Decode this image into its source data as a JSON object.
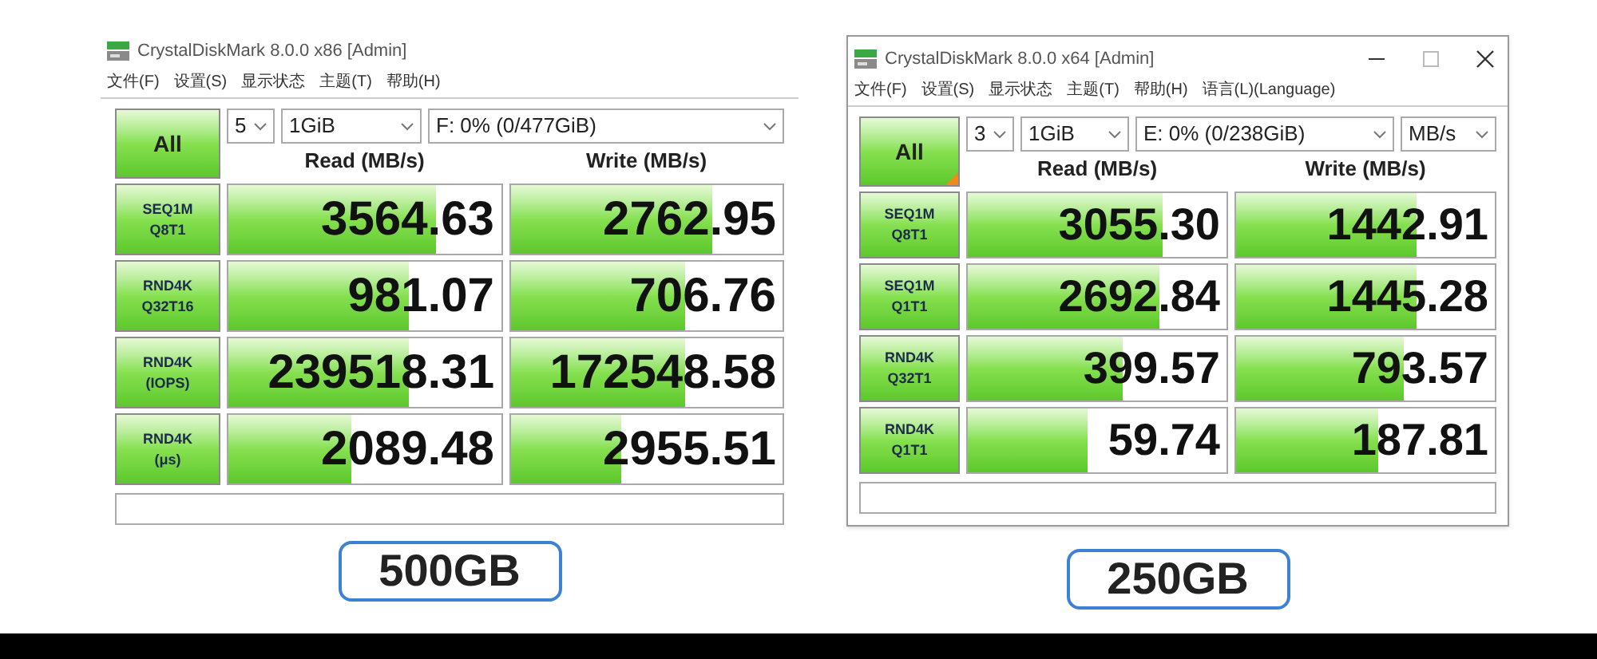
{
  "panels": [
    {
      "window": {
        "title": "CrystalDiskMark 8.0.0 x86 [Admin]",
        "window_controls": false
      },
      "menu": [
        "文件(F)",
        "设置(S)",
        "显示状态",
        "主题(T)",
        "帮助(H)"
      ],
      "all_button": {
        "label": "All",
        "marked": false
      },
      "settings": {
        "count": "5",
        "size": "1GiB",
        "drive": "F: 0% (0/477GiB)"
      },
      "columns": [
        "Read (MB/s)",
        "Write (MB/s)"
      ],
      "rows": [
        {
          "test": "SEQ1M",
          "params": "Q8T1",
          "read": {
            "value": "3564.63",
            "level": 0.76
          },
          "write": {
            "value": "2762.95",
            "level": 0.74
          }
        },
        {
          "test": "RND4K",
          "params": "Q32T16",
          "read": {
            "value": "981.07",
            "level": 0.66
          },
          "write": {
            "value": "706.76",
            "level": 0.64
          }
        },
        {
          "test": "RND4K",
          "params": "(IOPS)",
          "read": {
            "value": "239518.31",
            "level": 0.66
          },
          "write": {
            "value": "172548.58",
            "level": 0.64
          }
        },
        {
          "test": "RND4K",
          "params": "(μs)",
          "read": {
            "value": "2089.48",
            "level": 0.45
          },
          "write": {
            "value": "2955.51",
            "level": 0.41
          }
        }
      ],
      "caption": "500GB"
    },
    {
      "window": {
        "title": "CrystalDiskMark 8.0.0 x64 [Admin]",
        "window_controls": true
      },
      "menu": [
        "文件(F)",
        "设置(S)",
        "显示状态",
        "主题(T)",
        "帮助(H)",
        "语言(L)(Language)"
      ],
      "all_button": {
        "label": "All",
        "marked": true
      },
      "settings": {
        "count": "3",
        "size": "1GiB",
        "drive": "E: 0% (0/238GiB)",
        "unit": "MB/s"
      },
      "columns": [
        "Read (MB/s)",
        "Write (MB/s)"
      ],
      "rows": [
        {
          "test": "SEQ1M",
          "params": "Q8T1",
          "read": {
            "value": "3055.30",
            "level": 0.75
          },
          "write": {
            "value": "1442.91",
            "level": 0.7
          }
        },
        {
          "test": "SEQ1M",
          "params": "Q1T1",
          "read": {
            "value": "2692.84",
            "level": 0.74
          },
          "write": {
            "value": "1445.28",
            "level": 0.7
          }
        },
        {
          "test": "RND4K",
          "params": "Q32T1",
          "read": {
            "value": "399.57",
            "level": 0.6
          },
          "write": {
            "value": "793.57",
            "level": 0.65
          }
        },
        {
          "test": "RND4K",
          "params": "Q1T1",
          "read": {
            "value": "59.74",
            "level": 0.46
          },
          "write": {
            "value": "187.81",
            "level": 0.55
          }
        }
      ],
      "caption": "250GB"
    }
  ]
}
